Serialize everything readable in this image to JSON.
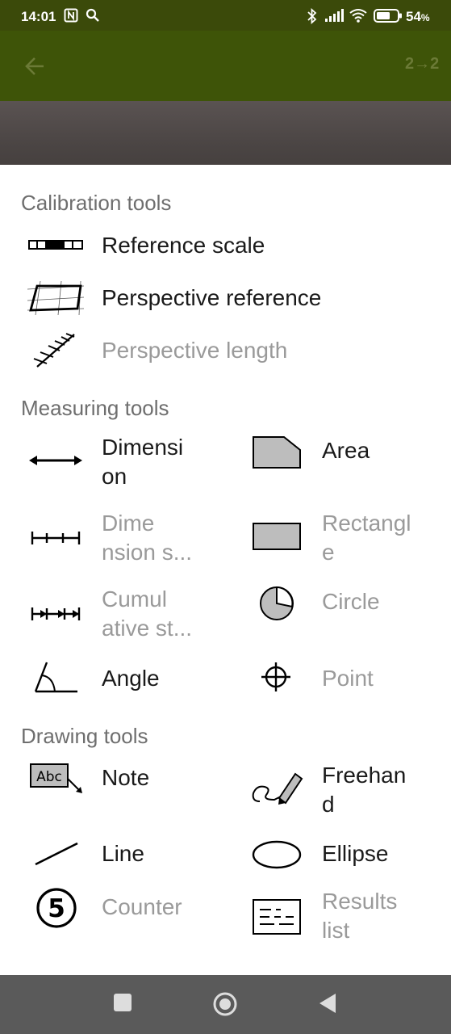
{
  "status_bar": {
    "time": "14:01",
    "battery": "54",
    "battery_unit": "%"
  },
  "app_bar": {
    "back_icon": "arrow-left-icon",
    "ratio_label": "2→2"
  },
  "sections": {
    "calibration": {
      "title": "Calibration tools",
      "items": [
        {
          "label": "Reference scale",
          "icon": "reference-scale-icon",
          "enabled": true
        },
        {
          "label": "Perspective reference",
          "icon": "perspective-reference-icon",
          "enabled": true
        },
        {
          "label": "Perspective length",
          "icon": "perspective-length-icon",
          "enabled": false
        }
      ]
    },
    "measuring": {
      "title": "Measuring tools",
      "items": [
        {
          "label_l1": "Dimensi",
          "label_l2": "on",
          "icon": "dimension-icon",
          "enabled": true
        },
        {
          "label": "Area",
          "icon": "area-icon",
          "enabled": true
        },
        {
          "label_l1": "Dime",
          "label_l2": "nsion s...",
          "icon": "dimension-string-icon",
          "enabled": false
        },
        {
          "label_l1": "Rectangl",
          "label_l2": "e",
          "icon": "rectangle-icon",
          "enabled": false
        },
        {
          "label_l1": "Cumul",
          "label_l2": "ative st...",
          "icon": "cumulative-string-icon",
          "enabled": false
        },
        {
          "label": "Circle",
          "icon": "circle-icon",
          "enabled": false
        },
        {
          "label": "Angle",
          "icon": "angle-icon",
          "enabled": true
        },
        {
          "label": "Point",
          "icon": "point-icon",
          "enabled": false
        }
      ]
    },
    "drawing": {
      "title": "Drawing tools",
      "items": [
        {
          "label": "Note",
          "icon": "note-icon",
          "icon_text": "Abc",
          "enabled": true
        },
        {
          "label_l1": "Freehan",
          "label_l2": "d",
          "icon": "freehand-icon",
          "enabled": true
        },
        {
          "label": "Line",
          "icon": "line-icon",
          "enabled": true
        },
        {
          "label": "Ellipse",
          "icon": "ellipse-icon",
          "enabled": true
        },
        {
          "label": "Counter",
          "icon": "counter-icon",
          "icon_text": "5",
          "enabled": false
        },
        {
          "label_l1": "Results",
          "label_l2": "list",
          "icon": "results-list-icon",
          "enabled": false
        }
      ]
    }
  },
  "nav_bar": {
    "recents": "square-icon",
    "home": "circle-home-icon",
    "back": "triangle-back-icon"
  }
}
